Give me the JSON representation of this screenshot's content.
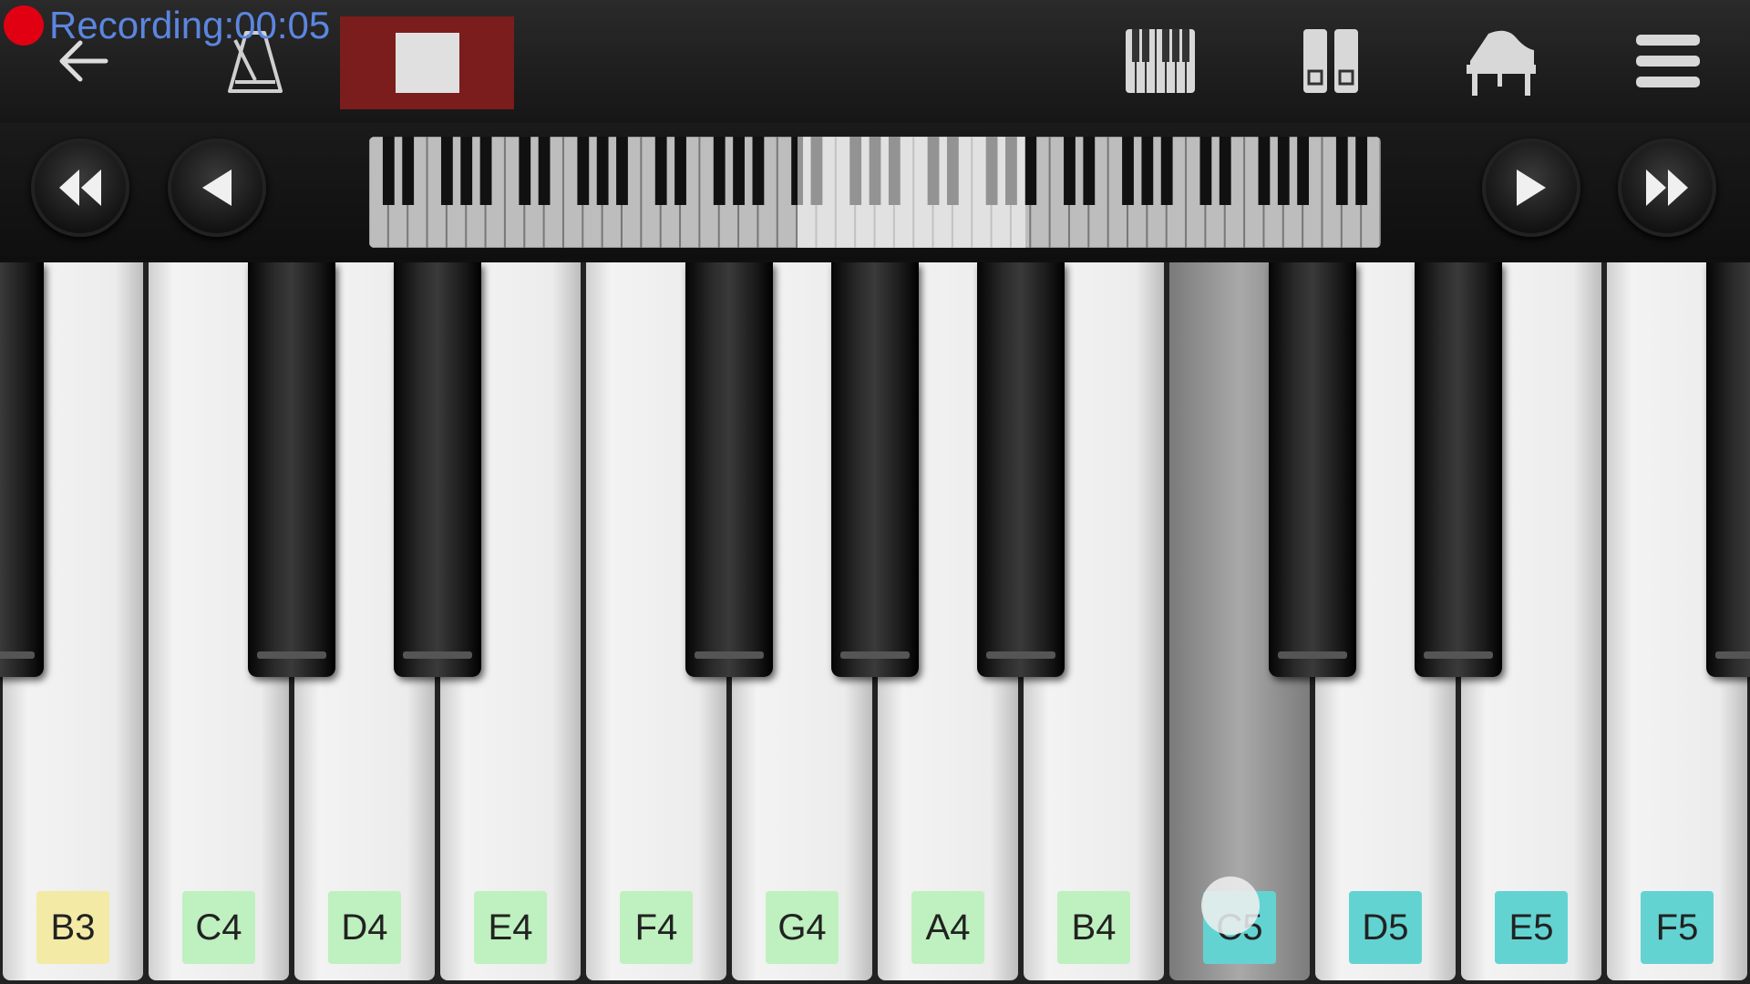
{
  "recording": {
    "label": "Recording",
    "time": "00:05"
  },
  "toolbar": {
    "icons": [
      "back-arrow-icon",
      "metronome-icon",
      "stop-icon",
      "keyboard-layout-icon",
      "dual-keyboard-icon",
      "grand-piano-icon",
      "menu-icon"
    ]
  },
  "navigation": {
    "icons": [
      "rewind-icon",
      "prev-icon",
      "next-icon",
      "fast-forward-icon"
    ]
  },
  "keyboard": {
    "white_keys": [
      "B3",
      "C4",
      "D4",
      "E4",
      "F4",
      "G4",
      "A4",
      "B4",
      "C5",
      "D5",
      "E5",
      "F5"
    ],
    "pressed_key": "C5",
    "label_colors": {
      "B3": "#f3eaa6",
      "C4": "#bff0bf",
      "D4": "#bff0bf",
      "E4": "#bff0bf",
      "F4": "#bff0bf",
      "G4": "#bff0bf",
      "A4": "#bff0bf",
      "B4": "#bff0bf",
      "C5": "#63d3d2",
      "D5": "#63d3d2",
      "E5": "#63d3d2",
      "F5": "#63d3d2"
    }
  },
  "colors": {
    "record_red": "#e10012",
    "record_text": "#5b86e0",
    "stop_button_bg": "#7b1d1d"
  }
}
